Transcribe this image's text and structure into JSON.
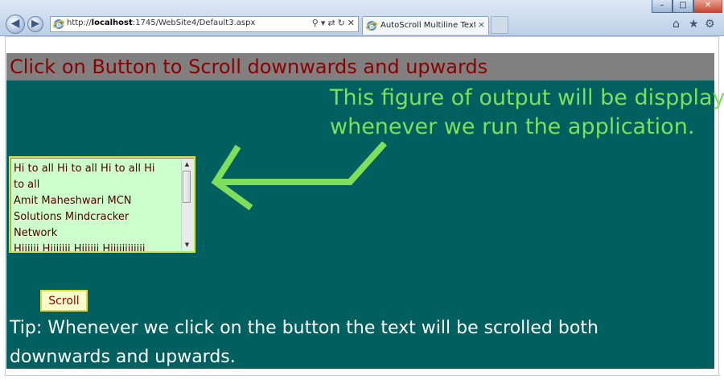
{
  "browser": {
    "url_prefix": "http://",
    "url_host": "localhost",
    "url_rest": ":1745/WebSite4/Default3.aspx",
    "tab_title": "AutoScroll Multiline TextBo...",
    "tab_close": "×",
    "nav_back": "◀",
    "nav_forward": "▶",
    "addr_tools": [
      "⚲",
      "▾",
      "⇄",
      "↻",
      "✕"
    ],
    "win_min": "–",
    "win_max": "□",
    "win_close": "✕",
    "home_icon": "⌂",
    "favorites_icon": "★",
    "tools_icon": "⚙"
  },
  "page": {
    "heading": "Click on Button to Scroll downwards and upwards",
    "annotation_line1": "This figure of output will be dispplay",
    "annotation_line2": "whenever we run the application.",
    "textbox_lines": [
      "Hi to all Hi to all Hi to all Hi",
      "to all",
      "Amit Maheshwari MCN",
      "Solutions Mindcracker",
      "Network",
      "Hiiiiii Hiiiiiii Hiiiiii Hiiiiiiiiiiii"
    ],
    "scroll_button": "Scroll",
    "tip_line1": "Tip: Whenever we click on the button the text will be scrolled both",
    "tip_line2": "downwards and upwards."
  },
  "colors": {
    "banner_bg": "#808080",
    "heading_text": "#8b0000",
    "panel_bg": "#006060",
    "annotation_text": "#7ee05a",
    "textbox_bg": "#ccffcc",
    "textbox_border": "#dede3a"
  }
}
